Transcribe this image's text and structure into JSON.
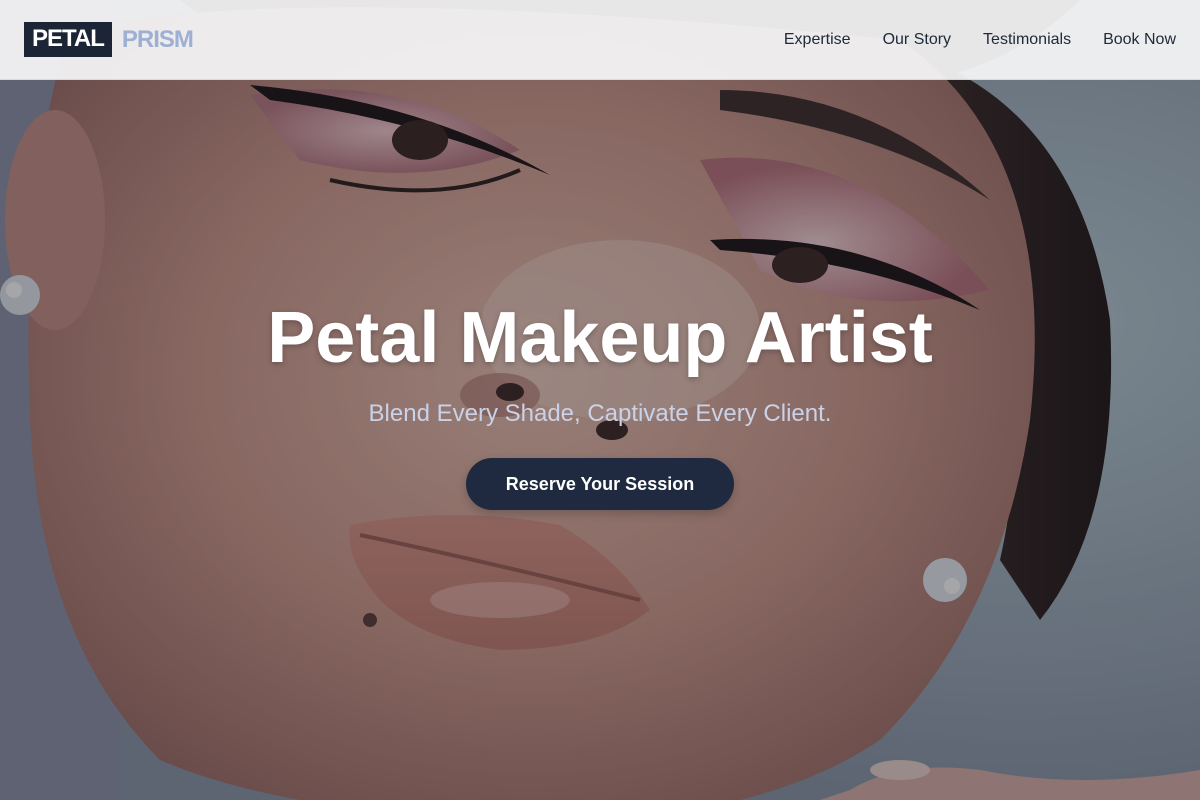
{
  "brand": {
    "logo_primary": "PETAL",
    "logo_secondary": "PRISM"
  },
  "nav": {
    "items": [
      {
        "label": "Expertise"
      },
      {
        "label": "Our Story"
      },
      {
        "label": "Testimonials"
      },
      {
        "label": "Book Now"
      }
    ]
  },
  "hero": {
    "title": "Petal Makeup Artist",
    "tagline": "Blend Every Shade, Captivate Every Client.",
    "cta_label": "Reserve Your Session",
    "background_description_icon": "portrait-photo"
  },
  "colors": {
    "brand_dark": "#1c2536",
    "brand_light": "#9db0d3",
    "cta_background": "#1f2a40",
    "tagline": "#c9d2e8"
  }
}
